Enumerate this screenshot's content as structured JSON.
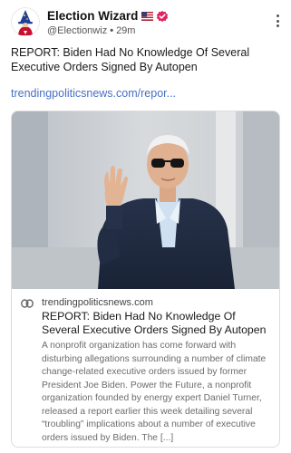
{
  "post": {
    "author_name": "Election Wizard",
    "handle": "@Electionwiz",
    "separator": "•",
    "time": "29m",
    "text": "REPORT: Biden Had No Knowledge Of Several Executive Orders Signed By Autopen",
    "link_text": "trendingpoliticsnews.com/repor..."
  },
  "card": {
    "domain": "trendingpoliticsnews.com",
    "title": "REPORT: Biden Had No Knowledge Of Several Executive Orders Signed By Autopen",
    "description": "A nonprofit organization has come forward with disturbing allegations surrounding a number of climate change-related executive orders issued by former President Joe Biden. Power the Future, a nonprofit organization founded by energy expert Daniel Turner, released a report earlier this week detailing several “troubling” implications about a number of executive orders issued by Biden. The [...]"
  },
  "icons": {
    "avatar": "wizard-avatar",
    "flag": "us-flag-icon",
    "verified": "verified-badge-icon",
    "more": "more-vertical-icon",
    "link": "link-icon"
  },
  "colors": {
    "link": "#4a6fc4",
    "verified": "#e0245e",
    "text": "#1a1a1a",
    "muted": "#6b6b6b"
  }
}
